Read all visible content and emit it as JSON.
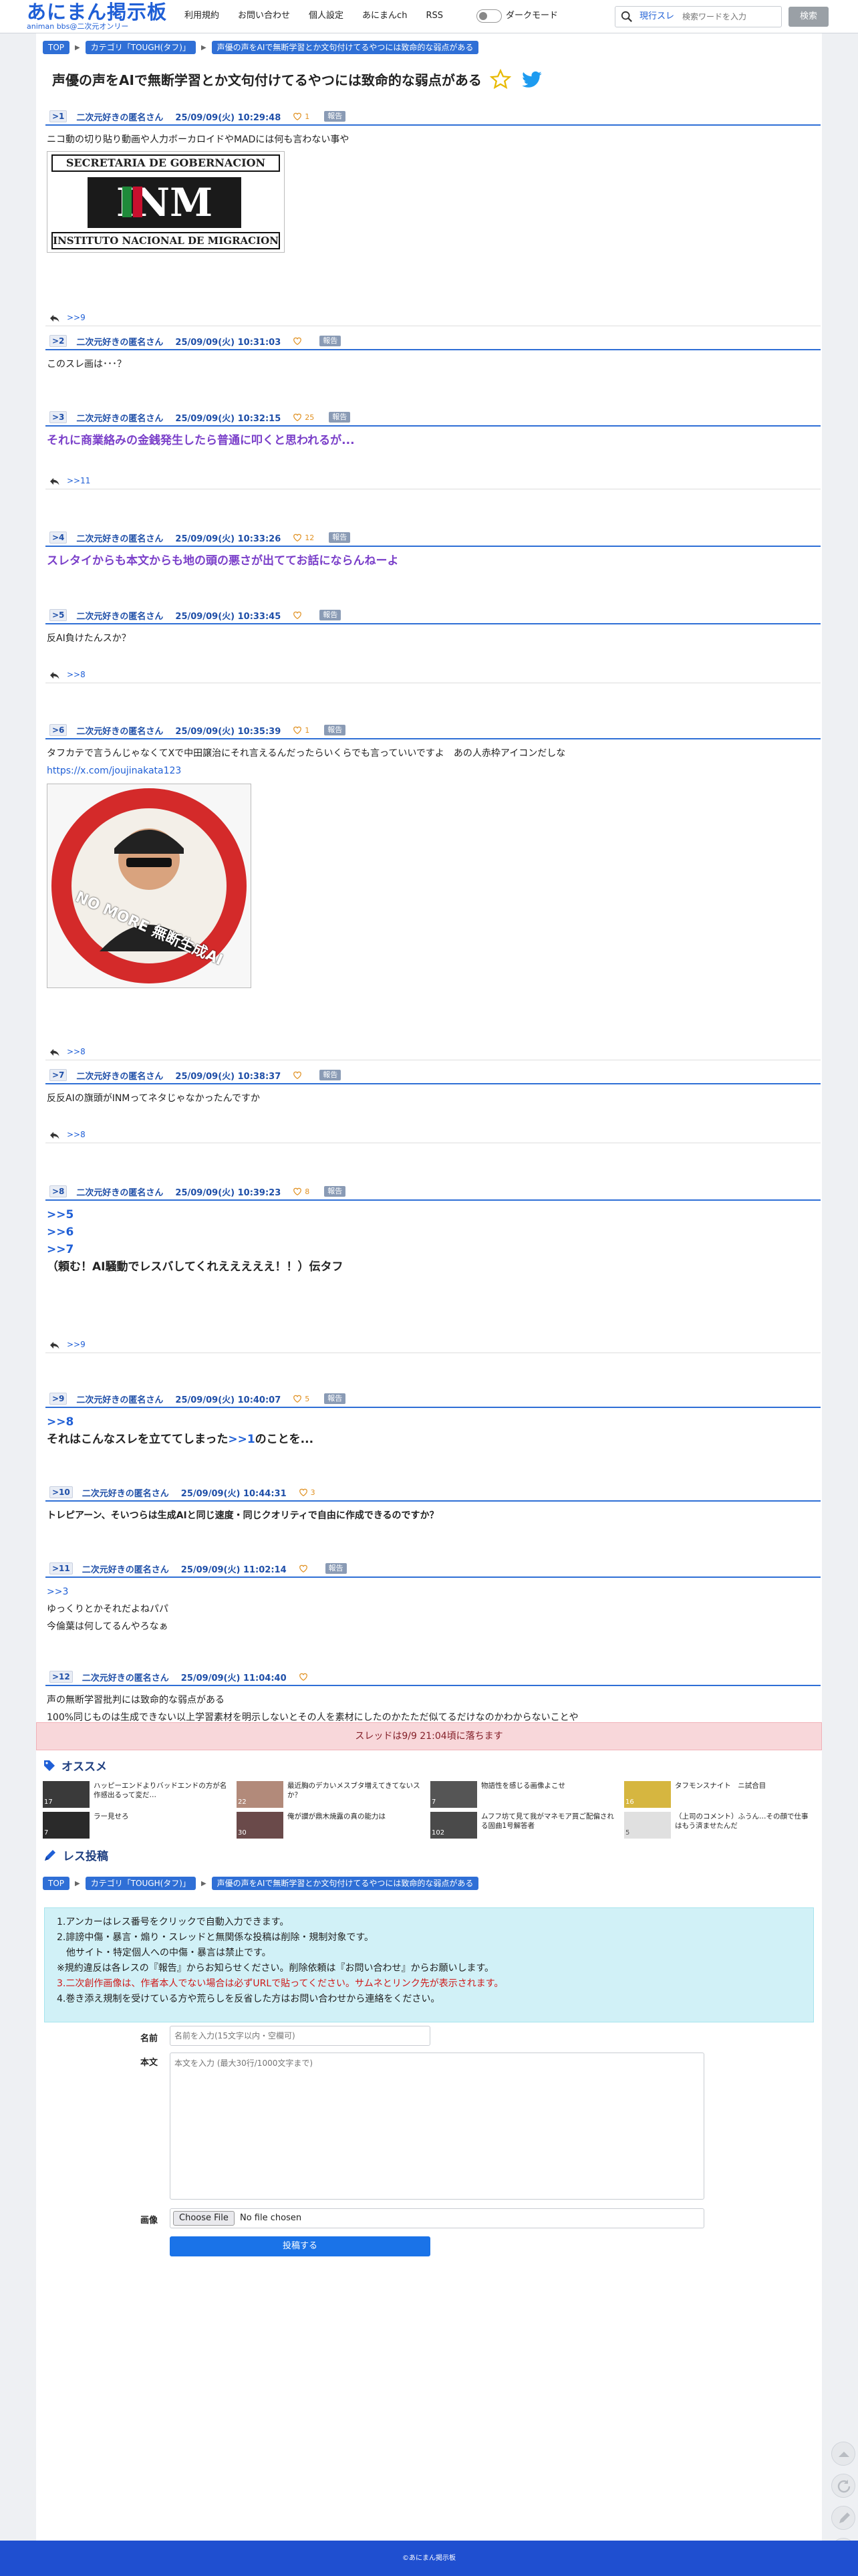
{
  "site": {
    "logo_title": "あにまん掲示板",
    "logo_sub": "animan bbs@二次元オンリー"
  },
  "nav": [
    "利用規約",
    "お問い合わせ",
    "個人設定",
    "あにまんch",
    "RSS"
  ],
  "dark_mode_label": "ダークモード",
  "search": {
    "scope": "現行スレ",
    "placeholder": "検索ワードを入力",
    "button": "検索"
  },
  "breadcrumb": {
    "top": "TOP",
    "category": "カテゴリ「TOUGH(タフ)」",
    "thread": "声優の声をAIで無断学習とか文句付けてるやつには致命的な弱点がある"
  },
  "thread_title": "声優の声をAIで無断学習とか文句付けてるやつには致命的な弱点がある",
  "report_label": "報告",
  "posts": [
    {
      "num": ">1",
      "name": "二次元好きの匿名さん",
      "date": "25/09/09(火) 10:29:48",
      "likes": "1",
      "lines": [
        "ニコ動の切り貼り動画や人力ボーカロイドやMADには何も言わない事や"
      ],
      "image_caption_top": "SECRETARIA DE GOBERNACION",
      "image_caption_bottom": "INSTITUTO NACIONAL DE MIGRACION",
      "image_logo": "INM",
      "reply_ref": ">>9"
    },
    {
      "num": ">2",
      "name": "二次元好きの匿名さん",
      "date": "25/09/09(火) 10:31:03",
      "likes": "",
      "lines": [
        "このスレ画は･･･？"
      ]
    },
    {
      "num": ">3",
      "name": "二次元好きの匿名さん",
      "date": "25/09/09(火) 10:32:15",
      "likes": "25",
      "lines": [
        "それに商業絡みの金銭発生したら普通に叩くと思われるが..."
      ],
      "reply_ref": ">>11"
    },
    {
      "num": ">4",
      "name": "二次元好きの匿名さん",
      "date": "25/09/09(火) 10:33:26",
      "likes": "12",
      "lines": [
        "スレタイからも本文からも地の頭の悪さが出ててお話にならんねーよ"
      ]
    },
    {
      "num": ">5",
      "name": "二次元好きの匿名さん",
      "date": "25/09/09(火) 10:33:45",
      "likes": "",
      "lines": [
        "反AI負けたんスか？"
      ],
      "reply_ref": ">>8"
    },
    {
      "num": ">6",
      "name": "二次元好きの匿名さん",
      "date": "25/09/09(火) 10:35:39",
      "likes": "1",
      "lines": [
        "タフカテで言うんじゃなくてXで中田譲治にそれ言えるんだったらいくらでも言っていいですよ　あの人赤枠アイコンだしな",
        "https://x.com/joujinakata123"
      ],
      "image_badge": "NO MORE 無断生成AI",
      "reply_ref": ">>8"
    },
    {
      "num": ">7",
      "name": "二次元好きの匿名さん",
      "date": "25/09/09(火) 10:38:37",
      "likes": "",
      "lines": [
        "反反AIの旗頭がINMってネタじゃなかったんですか"
      ],
      "reply_ref": ">>8"
    },
    {
      "num": ">8",
      "name": "二次元好きの匿名さん",
      "date": "25/09/09(火) 10:39:23",
      "likes": "8",
      "lines": [
        ">>5",
        ">>6",
        ">>7",
        "（頼む！AI騒動でレスバしてくれえええええ！！）伝タフ"
      ],
      "reply_ref": ">>9"
    },
    {
      "num": ">9",
      "name": "二次元好きの匿名さん",
      "date": "25/09/09(火) 10:40:07",
      "likes": "5",
      "lines": [
        ">>8",
        "それはこんなスレを立ててしまった",
        ">>1",
        "のことを..."
      ]
    },
    {
      "num": ">10",
      "name": "二次元好きの匿名さん",
      "date": "25/09/09(火) 10:44:31",
      "likes": "3",
      "lines": [
        "トレピアーン、そいつらは生成AIと同じ速度・同じクオリティで自由に作成できるのですか？"
      ]
    },
    {
      "num": ">11",
      "name": "二次元好きの匿名さん",
      "date": "25/09/09(火) 11:02:14",
      "likes": "",
      "lines": [
        ">>3",
        "ゆっくりとかそれだよねパパ",
        "今倫葉は何してるんやろなぁ"
      ]
    },
    {
      "num": ">12",
      "name": "二次元好きの匿名さん",
      "date": "25/09/09(火) 11:04:40",
      "likes": "",
      "lines": [
        "声の無断学習批判には致命的な弱点がある",
        "100%同じものは生成できない以上学習素材を明示しないとその人を素材にしたのかたただ似てるだけなのかわからないことや"
      ]
    }
  ],
  "thread_notice": "スレッドは9/9 21:04頃に落ちます",
  "recommend": {
    "title": "オススメ",
    "items": [
      {
        "title": "ハッピーエンドよりバッドエンドの方が名作感出るって変だ…",
        "count": "17"
      },
      {
        "title": "最近胸のデカいメスブタ増えてきてないスか？",
        "count": "22"
      },
      {
        "title": "物語性を感じる画像よこせ",
        "count": "7"
      },
      {
        "title": "タフモンスナイト　ニ試合目",
        "count": "16"
      },
      {
        "title": "ラー見せろ",
        "count": "7"
      },
      {
        "title": "俺が讃が鼎木焼露の真の能力は",
        "count": "30"
      },
      {
        "title": "ムフフ坊て見て我がマネモア買ご配偏される固曲1号解答者",
        "count": "102"
      },
      {
        "title": "（上司のコメント）ふうん…その顔で仕事はもう済ませたんだ",
        "count": "5"
      }
    ]
  },
  "post_form": {
    "title": "レス投稿",
    "rules": [
      "1.アンカーはレス番号をクリックで自動入力できます。",
      "2.誹謗中傷・暴言・煽り・スレッドと無関係な投稿は削除・規制対象です。",
      "　他サイト・特定個人への中傷・暴言は禁止です。",
      "※規約違反は各レスの『報告』からお知らせください。削除依頼は『お問い合わせ』からお願いします。",
      "3.二次創作画像は、作者本人でない場合は必ずURLで貼ってください。サムネとリンク先が表示されます。",
      "4.巻き添え規制を受けている方や荒らしを反省した方はお問い合わせから連絡をください。"
    ],
    "name_label": "名前",
    "name_placeholder": "名前を入力(15文字以内・空欄可)",
    "body_label": "本文",
    "body_placeholder": "本文を入力 (最大30行/1000文字まで)",
    "image_label": "画像",
    "file_button": "Choose File",
    "file_value": "No file chosen",
    "submit": "投稿する"
  },
  "footer": "©あにまん掲示板"
}
